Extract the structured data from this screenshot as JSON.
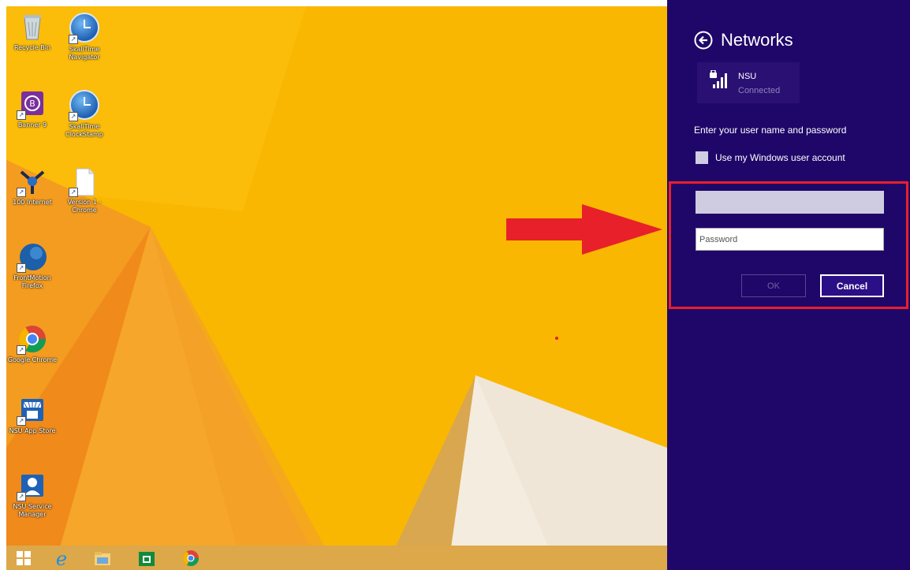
{
  "desktop": {
    "icons": [
      {
        "label": "Recycle Bin",
        "icon": "recycle-bin-icon"
      },
      {
        "label": "SkaliTime Navigator",
        "icon": "clock-app-icon"
      },
      {
        "label": "Banner 9",
        "icon": "banner-app-icon"
      },
      {
        "label": "SkaliTime ClockStamp",
        "icon": "clock-app-icon"
      },
      {
        "label": "100 Internet",
        "icon": "internet-tool-icon"
      },
      {
        "label": "Version 1 - Chrome",
        "icon": "document-icon"
      },
      {
        "label": "FrontMotion Firefox",
        "icon": "firefox-icon"
      },
      {
        "label": "Google Chrome",
        "icon": "chrome-icon"
      },
      {
        "label": "NSU App Store",
        "icon": "app-store-icon"
      },
      {
        "label": "NSU Service Manager",
        "icon": "service-manager-icon"
      }
    ],
    "colors": {
      "wallpaper": "#f9b701",
      "taskbar": "#dca84a"
    }
  },
  "taskbar": {
    "buttons": [
      "start-icon",
      "internet-explorer-icon",
      "file-explorer-icon",
      "store-icon",
      "chrome-icon"
    ]
  },
  "panel": {
    "title": "Networks",
    "network": {
      "name": "NSU",
      "status": "Connected"
    },
    "prompt": "Enter your user name and password",
    "use_windows_label": "Use my Windows user account",
    "username": {
      "value": "",
      "placeholder": ""
    },
    "password": {
      "value": "",
      "placeholder": "Password"
    },
    "ok_label": "OK",
    "cancel_label": "Cancel",
    "colors": {
      "background": "#1f0769",
      "highlight": "#e8202a",
      "arrow": "#e8202a"
    }
  }
}
